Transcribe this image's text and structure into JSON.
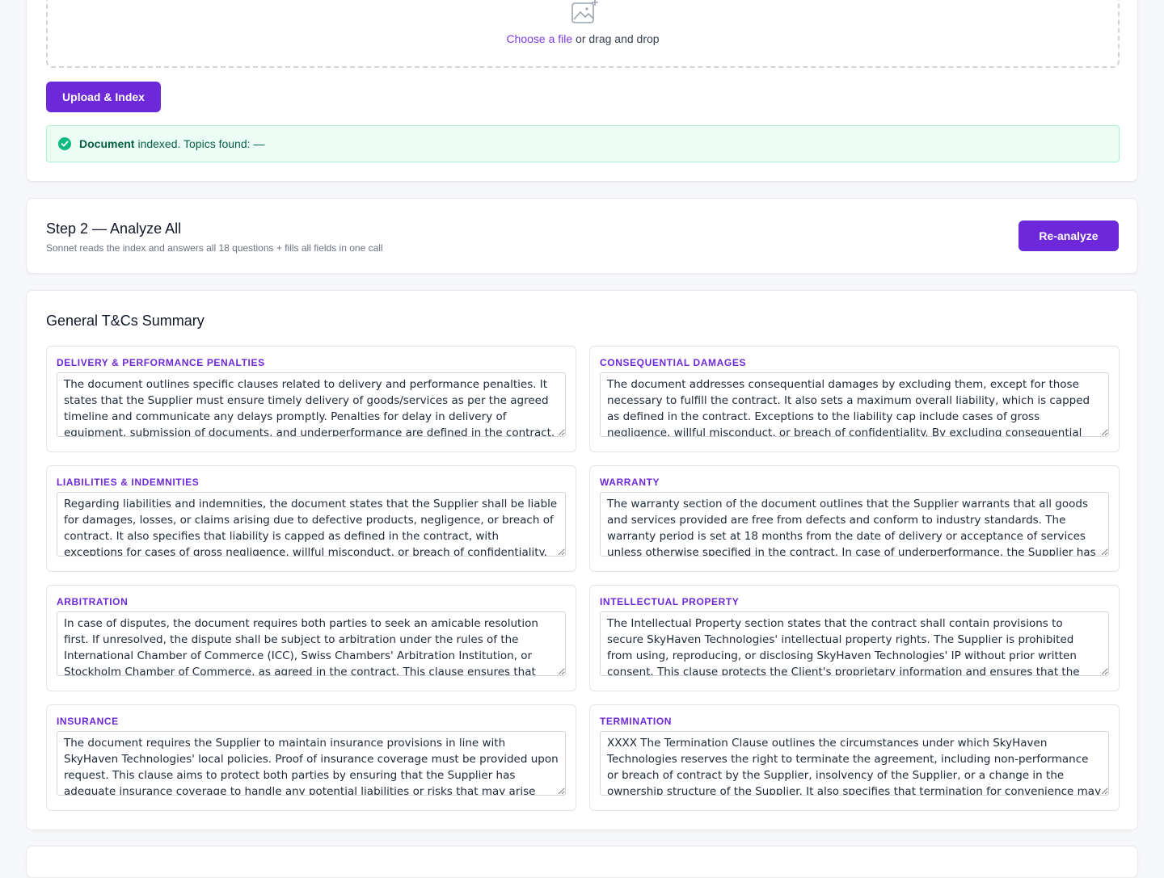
{
  "upload": {
    "choose_link": "Choose a file",
    "drop_text": " or drag and drop",
    "button_label": "Upload & Index",
    "status_strong": "Document",
    "status_text": "indexed. Topics found: —"
  },
  "step2": {
    "title": "Step 2 — Analyze All",
    "subtitle": "Sonnet reads the index and answers all 18 questions + fills all fields in one call",
    "button_label": "Re-analyze"
  },
  "summary": {
    "title": "General T&Cs Summary",
    "fields": [
      {
        "label": "DELIVERY & PERFORMANCE PENALTIES",
        "value": "The document outlines specific clauses related to delivery and performance penalties. It states that the Supplier must ensure timely delivery of goods/services as per the agreed timeline and communicate any delays promptly. Penalties for delay in delivery of equipment, submission of documents, and underperformance are defined in the contract. It also mentions that liquidated"
      },
      {
        "label": "CONSEQUENTIAL DAMAGES",
        "value": "The document addresses consequential damages by excluding them, except for those necessary to fulfill the contract. It also sets a maximum overall liability, which is capped as defined in the contract. Exceptions to the liability cap include cases of gross negligence, willful misconduct, or breach of confidentiality. By excluding consequential damages, the parties limit"
      },
      {
        "label": "LIABILITIES & INDEMNITIES",
        "value": "Regarding liabilities and indemnities, the document states that the Supplier shall be liable for damages, losses, or claims arising due to defective products, negligence, or breach of contract. It also specifies that liability is capped as defined in the contract, with exceptions for cases of gross negligence, willful misconduct, or breach of confidentiality. The Supplier's"
      },
      {
        "label": "WARRANTY",
        "value": "The warranty section of the document outlines that the Supplier warrants that all goods and services provided are free from defects and conform to industry standards. The warranty period is set at 18 months from the date of delivery or acceptance of services unless otherwise specified in the contract. In case of underperformance, the Supplier has a \"make good\""
      },
      {
        "label": "ARBITRATION",
        "value": "In case of disputes, the document requires both parties to seek an amicable resolution first. If unresolved, the dispute shall be subject to arbitration under the rules of the International Chamber of Commerce (ICC), Swiss Chambers' Arbitration Institution, or Stockholm Chamber of Commerce, as agreed in the contract. This clause ensures that any disagreements between"
      },
      {
        "label": "INTELLECTUAL PROPERTY",
        "value": "The Intellectual Property section states that the contract shall contain provisions to secure SkyHaven Technologies' intellectual property rights. The Supplier is prohibited from using, reproducing, or disclosing SkyHaven Technologies' IP without prior written consent. This clause protects the Client's proprietary information and ensures that the Supplier does not"
      },
      {
        "label": "INSURANCE",
        "value": "The document requires the Supplier to maintain insurance provisions in line with SkyHaven Technologies' local policies. Proof of insurance coverage must be provided upon request. This clause aims to protect both parties by ensuring that the Supplier has adequate insurance coverage to handle any potential liabilities or risks that may arise during the course of the"
      },
      {
        "label": "TERMINATION",
        "value": "XXXX The Termination Clause outlines the circumstances under which SkyHaven Technologies reserves the right to terminate the agreement, including non-performance or breach of contract by the Supplier, insolvency of the Supplier, or a change in the ownership structure of the Supplier. It also specifies that termination for convenience may occur, with compensation"
      }
    ]
  },
  "colors": {
    "accent": "#6d28d9",
    "success_bg": "#ecfdf5",
    "success_text": "#065f46"
  },
  "icons": [
    "image-plus-icon",
    "check-circle-icon",
    "resize-grip-icon"
  ]
}
